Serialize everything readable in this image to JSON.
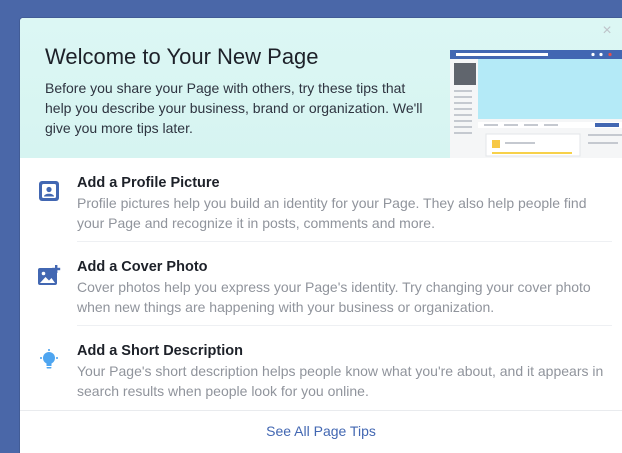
{
  "dialog": {
    "title": "Welcome to Your New Page",
    "intro": "Before you share your Page with others, try these tips that help you describe your business, brand or organization. We'll give you more tips later."
  },
  "tips": [
    {
      "icon": "profile-picture-icon",
      "title": "Add a Profile Picture",
      "body": "Profile pictures help you build an identity for your Page. They also help people find your Page and recognize it in posts, comments and more."
    },
    {
      "icon": "cover-photo-icon",
      "title": "Add a Cover Photo",
      "body": "Cover photos help you express your Page's identity. Try changing your cover photo when new things are happening with your business or organization."
    },
    {
      "icon": "lightbulb-icon",
      "title": "Add a Short Description",
      "body": "Your Page's short description helps people know what you're about, and it appears in search results when people look for you online."
    }
  ],
  "footer": {
    "link": "See All Page Tips"
  },
  "colors": {
    "accent": "#4267b2",
    "header_bg": "#d6f4f1",
    "backdrop": "#4a67a8"
  }
}
